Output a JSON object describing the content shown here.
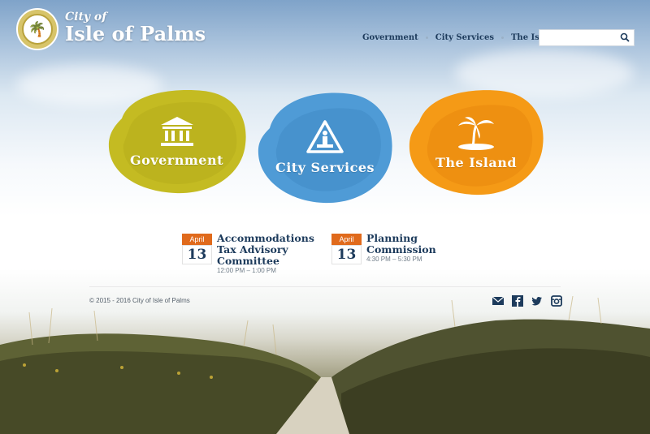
{
  "brand": {
    "prefix": "City of",
    "name": "Isle of Palms"
  },
  "nav": {
    "items": [
      "Government",
      "City Services",
      "The Island"
    ]
  },
  "search": {
    "placeholder": ""
  },
  "tiles": [
    {
      "label": "Government",
      "color": "#c4bb22",
      "icon": "courthouse-icon"
    },
    {
      "label": "City Services",
      "color": "#4f9bd6",
      "icon": "worker-sign-icon"
    },
    {
      "label": "The Island",
      "color": "#f59a16",
      "icon": "palm-island-icon"
    }
  ],
  "events": [
    {
      "month": "April",
      "day": "13",
      "title": [
        "Accommodations",
        "Tax Advisory",
        "Committee"
      ],
      "time": "12:00 PM – 1:00 PM"
    },
    {
      "month": "April",
      "day": "13",
      "title": [
        "Planning",
        "Commission"
      ],
      "time": "4:30 PM – 5:30 PM"
    }
  ],
  "footer": {
    "copyright": "© 2015 - 2016 City of Isle of Palms"
  },
  "social": [
    "mail-icon",
    "facebook-icon",
    "twitter-icon",
    "instagram-icon"
  ],
  "colors": {
    "navy": "#1d3b5c",
    "orange": "#e06a1c"
  }
}
